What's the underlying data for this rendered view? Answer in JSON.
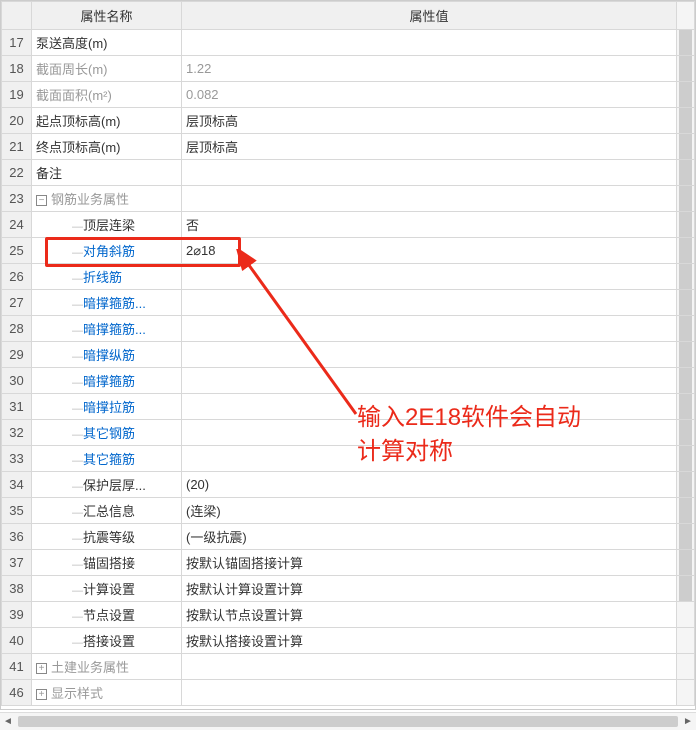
{
  "headers": {
    "rownum": "",
    "name": "属性名称",
    "value": "属性值"
  },
  "rows": [
    {
      "num": "17",
      "name": "泵送高度(m)",
      "value": "",
      "link": false,
      "indent": 0
    },
    {
      "num": "18",
      "name": "截面周长(m)",
      "value": "1.22",
      "link": true,
      "gray": true,
      "indent": 0
    },
    {
      "num": "19",
      "name": "截面面积(m²)",
      "value": "0.082",
      "link": true,
      "gray": true,
      "indent": 0
    },
    {
      "num": "20",
      "name": "起点顶标高(m)",
      "value": "层顶标高",
      "link": false,
      "indent": 0
    },
    {
      "num": "21",
      "name": "终点顶标高(m)",
      "value": "层顶标高",
      "link": false,
      "indent": 0
    },
    {
      "num": "22",
      "name": "备注",
      "value": "",
      "link": false,
      "indent": 0
    },
    {
      "num": "23",
      "name": "钢筋业务属性",
      "value": "",
      "link": false,
      "gray": true,
      "indent": 0,
      "expander": "−"
    },
    {
      "num": "24",
      "name": "顶层连梁",
      "value": "否",
      "link": false,
      "indent": 2
    },
    {
      "num": "25",
      "name": "对角斜筋",
      "value": "2⌀18",
      "link": true,
      "indent": 2
    },
    {
      "num": "26",
      "name": "折线筋",
      "value": "",
      "link": true,
      "indent": 2
    },
    {
      "num": "27",
      "name": "暗撑箍筋...",
      "value": "",
      "link": true,
      "indent": 2
    },
    {
      "num": "28",
      "name": "暗撑箍筋...",
      "value": "",
      "link": true,
      "indent": 2
    },
    {
      "num": "29",
      "name": "暗撑纵筋",
      "value": "",
      "link": true,
      "indent": 2
    },
    {
      "num": "30",
      "name": "暗撑箍筋",
      "value": "",
      "link": true,
      "indent": 2
    },
    {
      "num": "31",
      "name": "暗撑拉筋",
      "value": "",
      "link": true,
      "indent": 2
    },
    {
      "num": "32",
      "name": "其它钢筋",
      "value": "",
      "link": true,
      "indent": 2
    },
    {
      "num": "33",
      "name": "其它箍筋",
      "value": "",
      "link": true,
      "indent": 2
    },
    {
      "num": "34",
      "name": "保护层厚...",
      "value": "(20)",
      "link": false,
      "indent": 2
    },
    {
      "num": "35",
      "name": "汇总信息",
      "value": "(连梁)",
      "link": false,
      "indent": 2
    },
    {
      "num": "36",
      "name": "抗震等级",
      "value": "(一级抗震)",
      "link": false,
      "indent": 2
    },
    {
      "num": "37",
      "name": "锚固搭接",
      "value": "按默认锚固搭接计算",
      "link": false,
      "indent": 2
    },
    {
      "num": "38",
      "name": "计算设置",
      "value": "按默认计算设置计算",
      "link": false,
      "indent": 2
    },
    {
      "num": "39",
      "name": "节点设置",
      "value": "按默认节点设置计算",
      "link": false,
      "indent": 2
    },
    {
      "num": "40",
      "name": "搭接设置",
      "value": "按默认搭接设置计算",
      "link": false,
      "indent": 2
    },
    {
      "num": "41",
      "name": "土建业务属性",
      "value": "",
      "link": false,
      "gray": true,
      "indent": 0,
      "expander": "+"
    },
    {
      "num": "46",
      "name": "显示样式",
      "value": "",
      "link": false,
      "gray": true,
      "indent": 0,
      "expander": "+"
    }
  ],
  "annotation": {
    "line1": "输入2E18软件会自动",
    "line2": "计算对称"
  }
}
